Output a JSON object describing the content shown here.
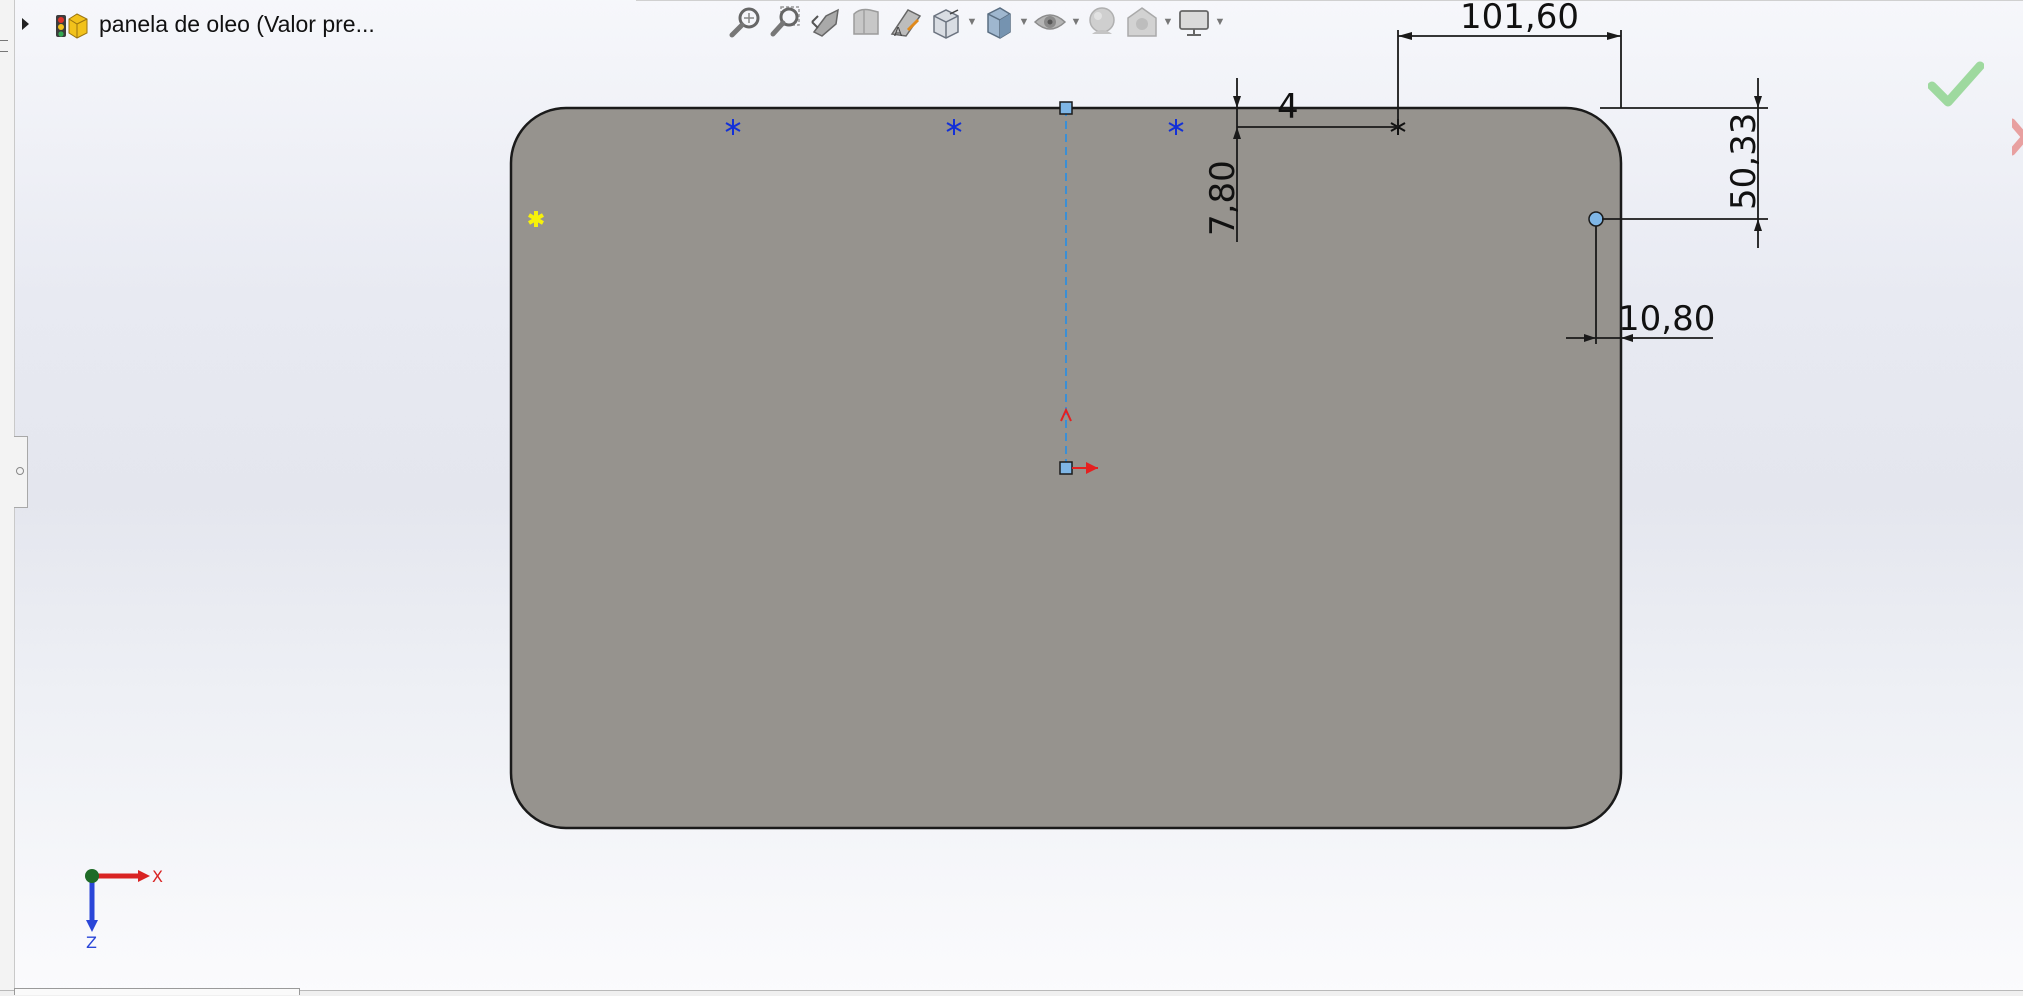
{
  "tree": {
    "label": "panela de oleo  (Valor pre...",
    "icon": "part-icon"
  },
  "toolbar": {
    "items": [
      {
        "name": "zoom-to-fit-icon",
        "dropdown": false
      },
      {
        "name": "zoom-to-area-icon",
        "dropdown": false
      },
      {
        "name": "previous-view-icon",
        "dropdown": false
      },
      {
        "name": "section-view-icon",
        "dropdown": false
      },
      {
        "name": "dynamic-annotation-icon",
        "dropdown": false
      },
      {
        "name": "view-orientation-icon",
        "dropdown": true
      },
      {
        "name": "display-style-icon",
        "dropdown": true
      },
      {
        "name": "hide-show-items-icon",
        "dropdown": true
      },
      {
        "name": "edit-appearance-icon",
        "dropdown": false
      },
      {
        "name": "apply-scene-icon",
        "dropdown": true
      },
      {
        "name": "view-settings-icon",
        "dropdown": true
      }
    ]
  },
  "dimensions": {
    "top_width": "101,60",
    "offset_small": "4",
    "offset_vertical": "7,80",
    "right_height": "50,33",
    "right_offset": "10,80"
  },
  "triad": {
    "x_label": "X",
    "z_label": "Z"
  },
  "colors": {
    "sketch_fill": "#96938e",
    "construction_line": "#3a8fd6",
    "accept_green": "#8fd48f"
  }
}
